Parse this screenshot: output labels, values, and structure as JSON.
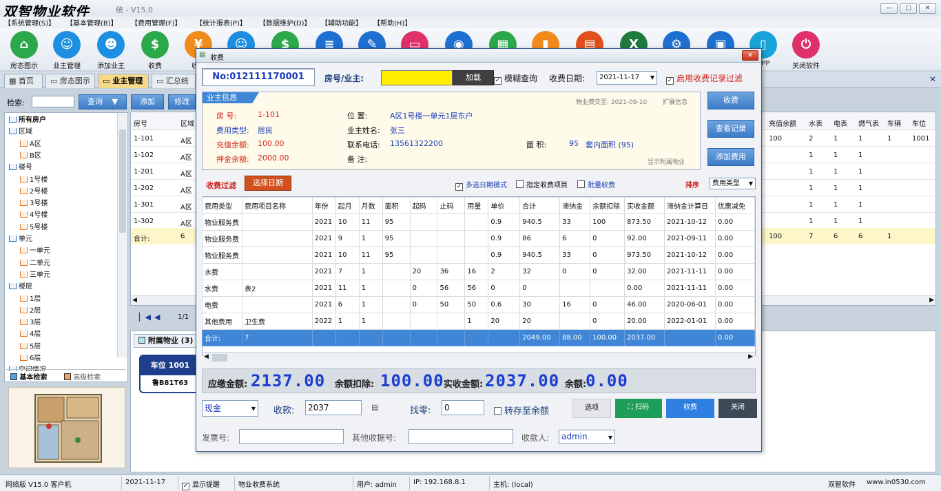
{
  "app": {
    "brand": "双智物业软件",
    "version": "V15.0",
    "title_hint": "统 - V15.0"
  },
  "window_buttons": [
    "—",
    "□",
    "✕"
  ],
  "menu": [
    "【系统管理(S)】",
    "【基本管理(B)】",
    "【费用管理(F)】",
    "【统计报表(P)】",
    "【数据维护(D)】",
    "【辅助功能】",
    "【帮助(H)】"
  ],
  "toolbar": [
    {
      "label": "房态图示",
      "icon": "house-icon",
      "color": "#2aa84a",
      "glyph": "⌂"
    },
    {
      "label": "业主管理",
      "icon": "users-icon",
      "color": "#1d8fe0",
      "glyph": "☺"
    },
    {
      "label": "添加业主",
      "icon": "user-add-icon",
      "color": "#1d8fe0",
      "glyph": "☻"
    },
    {
      "label": "收费",
      "icon": "dollar-icon",
      "color": "#2aa84a",
      "glyph": "$"
    },
    {
      "label": "收银",
      "icon": "cashier-icon",
      "color": "#f08a1c",
      "glyph": "¥"
    },
    {
      "label": "",
      "icon": "person-icon",
      "color": "#1d8fe0",
      "glyph": "☺"
    },
    {
      "label": "",
      "icon": "money-bag-icon",
      "color": "#2aa84a",
      "glyph": "$"
    },
    {
      "label": "",
      "icon": "list-icon",
      "color": "#1d6fd0",
      "glyph": "≡"
    },
    {
      "label": "",
      "icon": "edit-icon",
      "color": "#1d6fd0",
      "glyph": "✎"
    },
    {
      "label": "",
      "icon": "card-icon",
      "color": "#e0306a",
      "glyph": "▭"
    },
    {
      "label": "",
      "icon": "car-icon",
      "color": "#1d6fd0",
      "glyph": "◉"
    },
    {
      "label": "",
      "icon": "calculator-icon",
      "color": "#2aa84a",
      "glyph": "▦"
    },
    {
      "label": "",
      "icon": "chart-icon",
      "color": "#f08a1c",
      "glyph": "▮"
    },
    {
      "label": "",
      "icon": "printer-icon",
      "color": "#e0501c",
      "glyph": "▤"
    },
    {
      "label": "",
      "icon": "excel-icon",
      "color": "#1f7a3c",
      "glyph": "X"
    },
    {
      "label": "",
      "icon": "gear-icon",
      "color": "#1d6fd0",
      "glyph": "⚙"
    },
    {
      "label": "",
      "icon": "lock-icon",
      "color": "#1d6fd0",
      "glyph": "▣"
    },
    {
      "label": "APP",
      "icon": "app-icon",
      "color": "#18a4d8",
      "glyph": "▯"
    },
    {
      "label": "关闭软件",
      "icon": "power-icon",
      "color": "#e0306a",
      "glyph": "⏻"
    }
  ],
  "tabs": [
    "首页",
    "房态图示",
    "业主管理",
    "汇总统计"
  ],
  "left": {
    "search_label": "检索:",
    "query_btn": "查询",
    "add_btn": "添加",
    "edit_btn": "修改",
    "tree": [
      "所有房户",
      "区域",
      "A区",
      "B区",
      "楼号",
      "1号楼",
      "2号楼",
      "3号楼",
      "4号楼",
      "5号楼",
      "单元",
      "一单元",
      "二单元",
      "三单元",
      "楼层",
      "1层",
      "2层",
      "3层",
      "4层",
      "5层",
      "6层",
      "空间情况"
    ],
    "bottom_tabs": [
      "基本检索",
      "高级检索"
    ]
  },
  "grid": {
    "headers": [
      "房号",
      "区域"
    ],
    "rows": [
      [
        "1-101",
        "A区"
      ],
      [
        "1-102",
        "A区"
      ],
      [
        "1-201",
        "A区"
      ],
      [
        "1-202",
        "A区"
      ],
      [
        "1-301",
        "A区"
      ],
      [
        "1-302",
        "A区"
      ]
    ],
    "sum_label": "合计:",
    "sum_count": "6",
    "right_headers": [
      "充值余额",
      "水表",
      "电表",
      "燃气表",
      "车辆",
      "车位"
    ],
    "right_rows": [
      [
        "100",
        "2",
        "1",
        "1",
        "1",
        "1001"
      ],
      [
        "",
        "1",
        "1",
        "1",
        "",
        ""
      ],
      [
        "",
        "1",
        "1",
        "1",
        "",
        ""
      ],
      [
        "",
        "1",
        "1",
        "1",
        "",
        ""
      ],
      [
        "",
        "1",
        "1",
        "1",
        "",
        ""
      ],
      [
        "",
        "1",
        "1",
        "1",
        "",
        ""
      ]
    ],
    "right_sum": [
      "100",
      "7",
      "6",
      "6",
      "1",
      ""
    ],
    "pager": "1/1"
  },
  "attached": {
    "tab": "附属物业 (3)",
    "card_title": "车位 1001",
    "plate": "鲁B81T63"
  },
  "modal": {
    "title": "收费",
    "ticket_no": "No:012111170001",
    "room_label": "房号/业主:",
    "load_btn": "加载",
    "fuzzy_label": "模糊查询",
    "date_label": "收费日期:",
    "date_value": "2021-11-17",
    "enable_filter_label": "启用收费记录过滤",
    "owner_info_title": "业主信息",
    "paid_until": "物业费交至: 2021-09-10",
    "expand_info": "扩展信息",
    "room_k": "房    号:",
    "room_v": "1-101",
    "fee_type_k": "费用类型:",
    "fee_type_v": "居民",
    "charge_bal_k": "充值余额:",
    "charge_bal_v": "100.00",
    "deposit_k": "押金余额:",
    "deposit_v": "2000.00",
    "location_k": "位    置:",
    "location_v": "A区1号楼一单元1层东户",
    "owner_k": "业主姓名:",
    "owner_v": "张三",
    "phone_k": "联系电话:",
    "phone_v": "13561322200",
    "remark_k": "备    注:",
    "area_k": "面    积:",
    "area_v": "95",
    "inner_area": "套内面积 (95)",
    "show_attached": "显示附属物业",
    "side_btns": [
      "收费",
      "查看记录",
      "添加费用"
    ],
    "filter_label": "收费过滤",
    "select_date_btn": "选择日期",
    "multi_date": "多选日期模式",
    "specified_items": "指定收费项目",
    "batch_charge": "批量收费",
    "sort_label": "排序",
    "sort_value": "费用类型",
    "fee_headers": [
      "费用类型",
      "费用项目名称",
      "年份",
      "起月",
      "月数",
      "面积",
      "起码",
      "止码",
      "用量",
      "单价",
      "合计",
      "滞纳金",
      "余额扣除",
      "实收金额",
      "滞纳金计算日",
      "优惠减免"
    ],
    "fee_rows": [
      [
        "物业服务费",
        "",
        "2021",
        "10",
        "11",
        "95",
        "",
        "",
        "",
        "0.9",
        "940.5",
        "33",
        "100",
        "873.50",
        "2021-10-12",
        "0.00"
      ],
      [
        "物业服务费",
        "",
        "2021",
        "9",
        "1",
        "95",
        "",
        "",
        "",
        "0.9",
        "86",
        "6",
        "0",
        "92.00",
        "2021-09-11",
        "0.00"
      ],
      [
        "物业服务费",
        "",
        "2021",
        "10",
        "11",
        "95",
        "",
        "",
        "",
        "0.9",
        "940.5",
        "33",
        "0",
        "973.50",
        "2021-10-12",
        "0.00"
      ],
      [
        "水费",
        "",
        "2021",
        "7",
        "1",
        "",
        "20",
        "36",
        "16",
        "2",
        "32",
        "0",
        "0",
        "32.00",
        "2021-11-11",
        "0.00"
      ],
      [
        "水费",
        "表2",
        "2021",
        "11",
        "1",
        "",
        "0",
        "56",
        "56",
        "0",
        "0",
        "",
        "",
        "0.00",
        "2021-11-11",
        "0.00"
      ],
      [
        "电费",
        "",
        "2021",
        "6",
        "1",
        "",
        "0",
        "50",
        "50",
        "0.6",
        "30",
        "16",
        "0",
        "46.00",
        "2020-06-01",
        "0.00"
      ],
      [
        "其他费用",
        "卫生费",
        "2022",
        "1",
        "1",
        "",
        "",
        "",
        "1",
        "20",
        "20",
        "",
        "0",
        "20.00",
        "2022-01-01",
        "0.00"
      ]
    ],
    "fee_sum": [
      "合计:",
      "7",
      "",
      "",
      "",
      "",
      "",
      "",
      "",
      "",
      "2049.00",
      "88.00",
      "100.00",
      "2037.00",
      "",
      "0.00"
    ],
    "due_label": "应缴金额:",
    "due_value": "2137.00",
    "deduct_label": "余额扣除:",
    "deduct_value": "100.00",
    "actual_label": "实收金额:",
    "actual_value": "2037.00",
    "balance_label": "余额:",
    "balance_value": "0.00",
    "pay_method": "现金",
    "receive_label": "收款:",
    "receive_value": "2037",
    "change_label": "找零:",
    "change_value": "0",
    "save_to_balance": "转存至余额",
    "btn_options": "选项",
    "btn_scan": "扫码",
    "btn_charge": "收费",
    "btn_close": "关闭",
    "invoice_label": "发票号:",
    "other_receipt_label": "其他收据号:",
    "payee_label": "收款人:",
    "payee_value": "admin"
  },
  "status": [
    "网络版 V15.0  客户机",
    "2021-11-17",
    "显示提醒",
    "物业收费系统",
    "用户: admin",
    "IP: 192.168.8.1",
    "主机: (local)",
    "双智软件",
    "www.in0530.com"
  ]
}
